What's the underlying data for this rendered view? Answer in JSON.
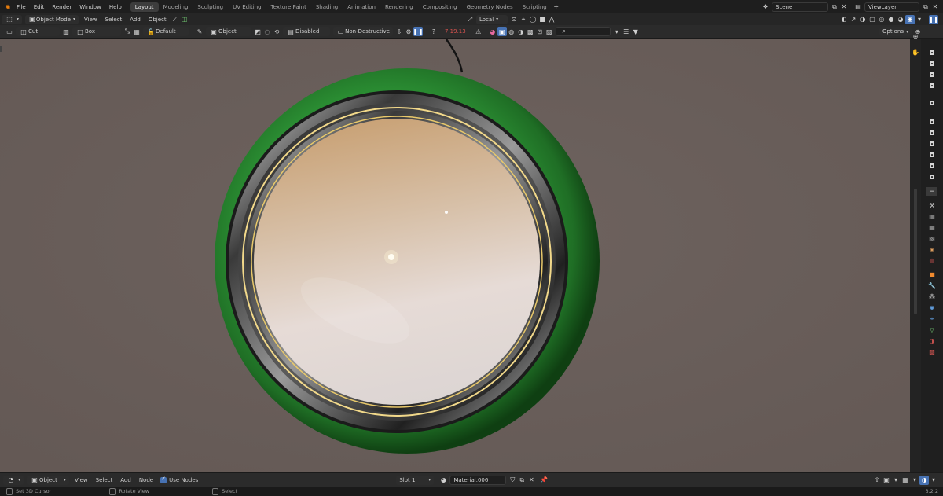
{
  "menubar": {
    "menus": [
      "File",
      "Edit",
      "Render",
      "Window",
      "Help"
    ],
    "workspaces": [
      "Layout",
      "Modeling",
      "Sculpting",
      "UV Editing",
      "Texture Paint",
      "Shading",
      "Animation",
      "Rendering",
      "Compositing",
      "Geometry Nodes",
      "Scripting"
    ],
    "add_tab": "+",
    "scene": "Scene",
    "view_layer": "ViewLayer"
  },
  "header3d": {
    "mode": "Object Mode",
    "menus": [
      "View",
      "Select",
      "Add",
      "Object"
    ],
    "pivot": "Local"
  },
  "toolbar": {
    "cut": "Cut",
    "box": "Box",
    "default": "Default",
    "object": "Object",
    "disabled": "Disabled",
    "non_destructive": "Non-Destructive",
    "value": "7.19.13",
    "options": "Options"
  },
  "bottom": {
    "context": "Object",
    "menus": [
      "View",
      "Select",
      "Add",
      "Node"
    ],
    "use_nodes": "Use Nodes",
    "slot": "Slot 1",
    "material": "Material.006"
  },
  "status": {
    "a": "Set 3D Cursor",
    "b": "Rotate View",
    "c": "Select",
    "version": "3.2.2"
  },
  "colors": {
    "accent": "#4772b3",
    "viewport_bg": "#6b605c",
    "warning_value": "#d9534f"
  }
}
